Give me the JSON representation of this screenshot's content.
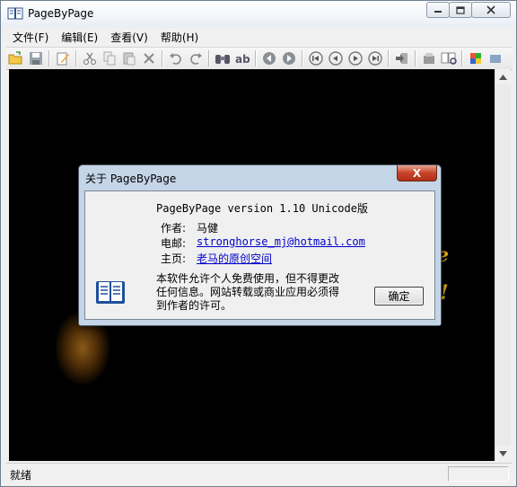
{
  "window": {
    "title": "PageByPage"
  },
  "menu": {
    "items": [
      "文件(F)",
      "编辑(E)",
      "查看(V)",
      "帮助(H)"
    ]
  },
  "toolbar": {
    "icons": [
      "open-folder-icon",
      "save-icon",
      "edit-icon",
      "cut-icon",
      "copy-icon",
      "paste-icon",
      "delete-icon",
      "undo-icon",
      "redo-icon",
      "find-icon",
      "replace-icon",
      "back-icon",
      "forward-icon",
      "first-page-icon",
      "prev-page-icon",
      "next-page-icon",
      "last-page-icon",
      "goto-icon",
      "export-icon",
      "book-view-icon",
      "plugin-icon",
      "extra-icon"
    ]
  },
  "status": {
    "text": "就绪"
  },
  "colors": {
    "accent_close": "#c7432a",
    "link": "#0000cc",
    "text_glow": "#f0b818"
  },
  "content": {
    "visible_fragments": [
      "e",
      "!"
    ]
  },
  "dialog": {
    "title": "关于 PageByPage",
    "close_label": "X",
    "version": "PageByPage version 1.10 Unicode版",
    "author_label": "作者:",
    "author_value": "马健",
    "email_label": "电邮:",
    "email_value": "stronghorse_mj@hotmail.com",
    "home_label": "主页:",
    "home_value": "老马的原创空间",
    "notice_line1": "本软件允许个人免费使用，但不得更改",
    "notice_line2": "任何信息。网站转载或商业应用必须得",
    "notice_line3": "到作者的许可。",
    "ok_label": "确定"
  }
}
